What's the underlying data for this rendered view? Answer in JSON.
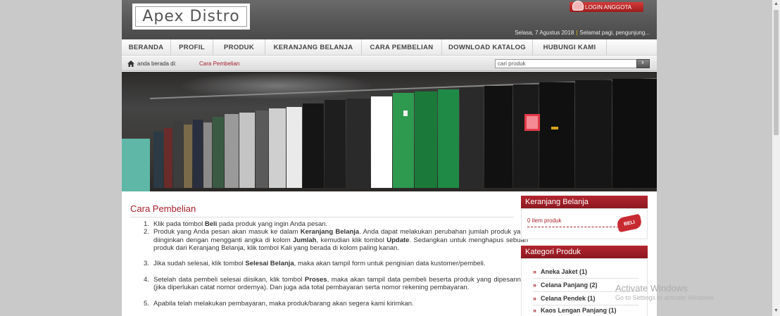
{
  "header": {
    "logo_text": "Apex Distro",
    "login_label": "LOGIN ANGGOTA",
    "date_text": "Selasa, 7 Agustus 2018",
    "greeting_text": "Selamat pagi, pengunjung..."
  },
  "nav": {
    "items": [
      "BERANDA",
      "PROFIL",
      "PRODUK",
      "KERANJANG BELANJA",
      "CARA PEMBELIAN",
      "DOWNLOAD KATALOG",
      "HUBUNGI KAMI"
    ]
  },
  "breadcrumb": {
    "label": "anda berada di:",
    "current": "Cara Pembelian"
  },
  "search": {
    "value": "cari produk"
  },
  "main": {
    "title": "Cara Pembelian",
    "steps": [
      "Klik pada tombol Beli pada produk yang ingin Anda pesan.",
      "Produk yang Anda pesan akan masuk ke dalam Keranjang Belanja. Anda dapat melakukan perubahan jumlah produk yang diinginkan dengan mengganti angka di kolom Jumlah, kemudian klik tombol Update. Sedangkan untuk menghapus sebuah produk dari Keranjang Belanja, klik tombol Kali yang berada di kolom paling kanan.",
      "Jika sudah selesai, klik tombol Selesai Belanja, maka akan tampil form untuk pengisian data kustomer/pembeli.",
      "Setelah data pembeli selesai diisikan, klik tombol Proses, maka akan tampil data pembeli beserta produk yang dipesannya (jika diperlukan catat nomor ordernya). Dan juga ada total pembayaran serta nomor rekening pembayaran.",
      "Apabila telah melakukan pembayaran, maka produk/barang akan segera kami kirimkan."
    ]
  },
  "sidebar": {
    "cart_title": "Keranjang Belanja",
    "cart_text": "0 item produk",
    "cart_badge": "BELI",
    "category_title": "Kategori Produk",
    "categories": [
      "Aneka Jaket (1)",
      "Celana Panjang (2)",
      "Celana Pendek (1)",
      "Kaos Lengan Panjang (1)"
    ]
  },
  "watermark": {
    "line1": "Activate Windows",
    "line2": "Go to Settings to activate Windows."
  },
  "colors": {
    "accent": "#a6212a",
    "header_bg": "#5a5a5a",
    "page_bg": "#c9c9c9"
  }
}
